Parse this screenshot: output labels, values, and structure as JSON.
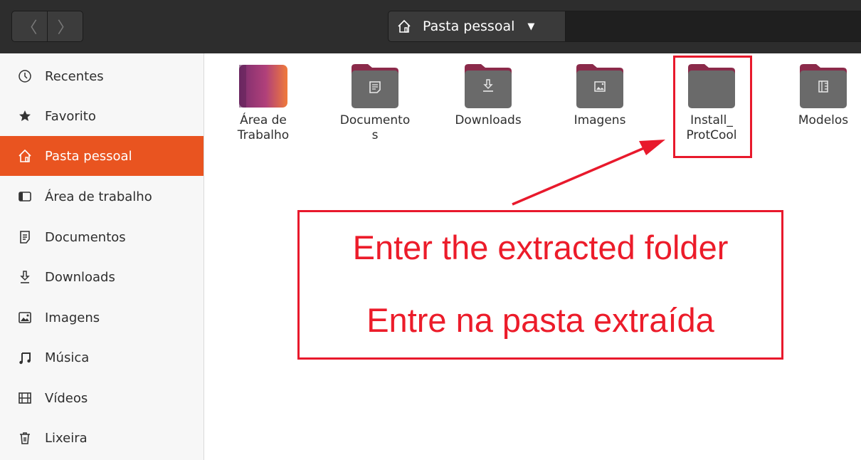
{
  "header": {
    "back_glyph": "〈",
    "forward_glyph": "〉",
    "location_label": "Pasta pessoal"
  },
  "sidebar": {
    "items": [
      {
        "label": "Recentes",
        "icon": "clock-icon"
      },
      {
        "label": "Favorito",
        "icon": "star-icon"
      },
      {
        "label": "Pasta pessoal",
        "icon": "home-icon",
        "active": true
      },
      {
        "label": "Área de trabalho",
        "icon": "desktop-icon"
      },
      {
        "label": "Documentos",
        "icon": "document-icon"
      },
      {
        "label": "Downloads",
        "icon": "download-icon"
      },
      {
        "label": "Imagens",
        "icon": "image-icon"
      },
      {
        "label": "Música",
        "icon": "music-icon"
      },
      {
        "label": "Vídeos",
        "icon": "video-icon"
      },
      {
        "label": "Lixeira",
        "icon": "trash-icon"
      }
    ]
  },
  "files": [
    {
      "label": "Área de\nTrabalho",
      "icon": "desktop-folder-icon"
    },
    {
      "label": "Documento\ns",
      "icon": "documents-folder-icon"
    },
    {
      "label": "Downloads",
      "icon": "downloads-folder-icon"
    },
    {
      "label": "Imagens",
      "icon": "pictures-folder-icon"
    },
    {
      "label": "Install_\nProtCool",
      "icon": "folder-icon"
    },
    {
      "label": "Modelos",
      "icon": "templates-folder-icon"
    }
  ],
  "annotation": {
    "line1": "Enter the extracted folder",
    "line2": "Entre na pasta extraída",
    "color": "#e8192c"
  },
  "colors": {
    "accent": "#e95420",
    "headerbar": "#2d2d2d"
  }
}
